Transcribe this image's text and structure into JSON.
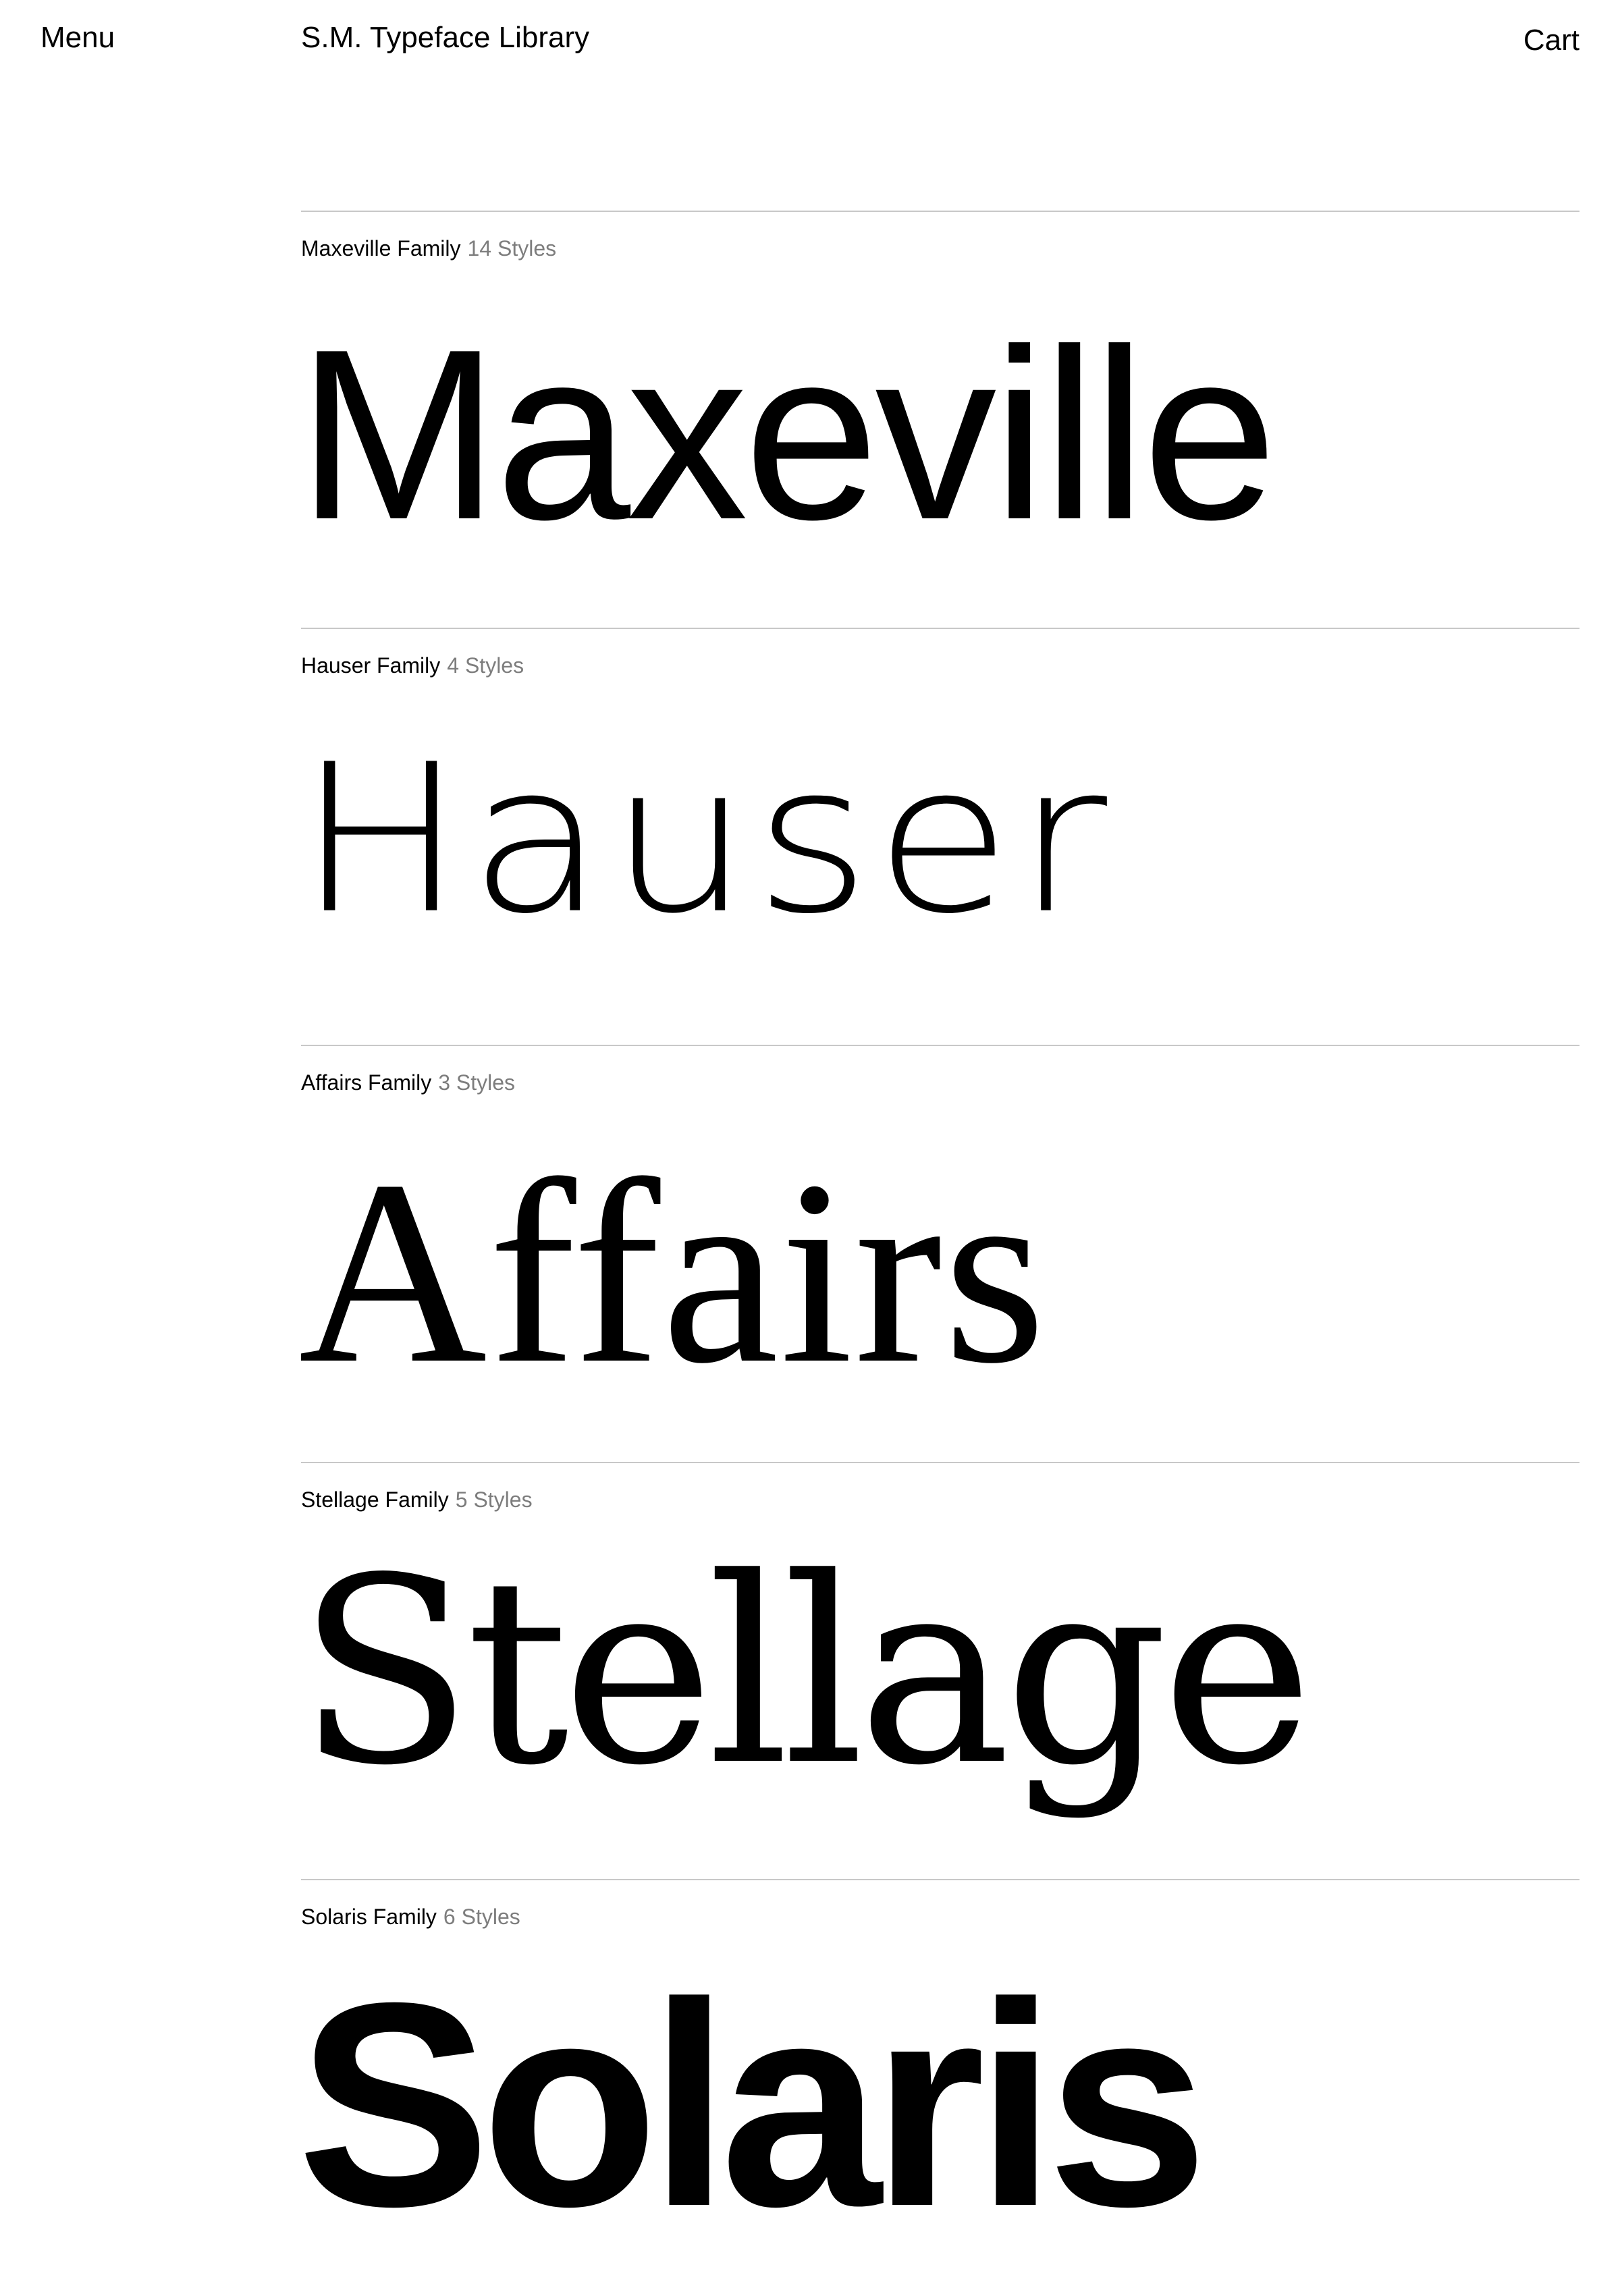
{
  "header": {
    "menu_label": "Menu",
    "title": "S.M. Typeface Library",
    "cart_label": "Cart"
  },
  "families": [
    {
      "name": "Maxeville Family",
      "styles": "14 Styles",
      "specimen": "Maxeville"
    },
    {
      "name": "Hauser Family",
      "styles": "4 Styles",
      "specimen": "Hauser"
    },
    {
      "name": "Affairs Family",
      "styles": "3 Styles",
      "specimen": "Affairs"
    },
    {
      "name": "Stellage Family",
      "styles": "5 Styles",
      "specimen": "Stellage"
    },
    {
      "name": "Solaris Family",
      "styles": "6 Styles",
      "specimen": "Solaris"
    }
  ],
  "colors": {
    "text": "#000000",
    "muted": "#7d7d7d",
    "divider": "#c8c8c8",
    "background": "#ffffff"
  }
}
